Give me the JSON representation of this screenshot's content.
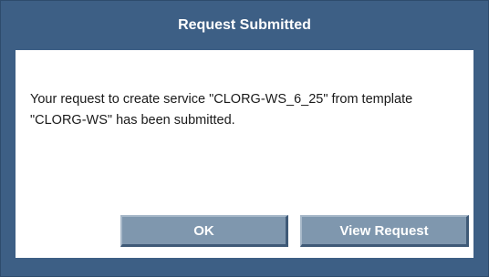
{
  "dialog": {
    "title": "Request Submitted",
    "message": "Your request to create service \"CLORG-WS_6_25\" from template \"CLORG-WS\" has been submitted.",
    "buttons": {
      "ok_label": "OK",
      "view_request_label": "View Request"
    }
  },
  "colors": {
    "frame": "#3d5f85",
    "button": "#7f97ae",
    "title_text": "#ffffff"
  }
}
